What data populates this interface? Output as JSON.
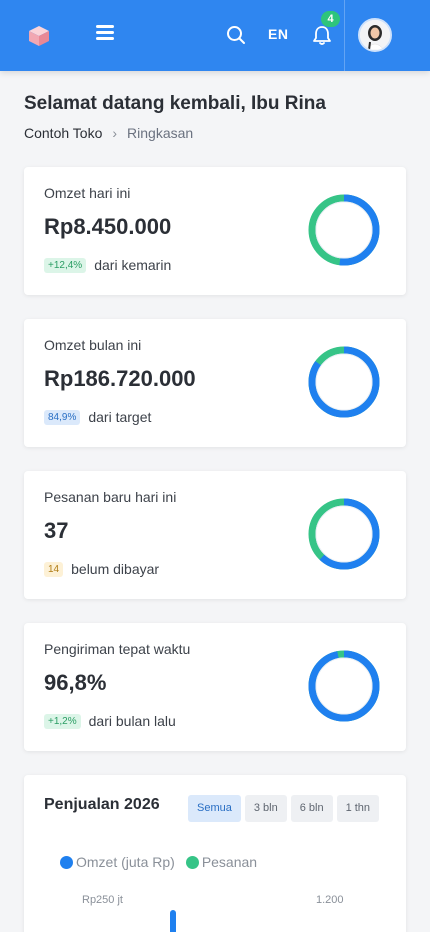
{
  "header": {
    "language": "EN",
    "notifications_count": "4",
    "accent": "#2f86f0"
  },
  "greeting": "Selamat datang kembali, Ibu Rina",
  "breadcrumb": {
    "items": [
      "Contoh Toko",
      "Ringkasan"
    ],
    "separator": "›"
  },
  "stats": [
    {
      "label": "Omzet hari ini",
      "value": "Rp8.450.000",
      "badge": "+12,4%",
      "badge_color": "green",
      "foot": "dari kemarin",
      "donut_fraction": 0.52
    },
    {
      "label": "Omzet bulan ini",
      "value": "Rp186.720.000",
      "badge": "84,9%",
      "badge_color": "blue",
      "foot": "dari target",
      "donut_fraction": 0.849
    },
    {
      "label": "Pesanan baru hari ini",
      "value": "37",
      "badge": "14",
      "badge_color": "yellow",
      "foot": "belum dibayar",
      "donut_fraction": 0.62
    },
    {
      "label": "Pengiriman tepat waktu",
      "value": "96,8%",
      "badge": "+1,2%",
      "badge_color": "green",
      "foot": "dari bulan lalu",
      "donut_fraction": 0.968
    }
  ],
  "colors": {
    "blue": "#1f80ef",
    "green": "#36c487"
  },
  "sales": {
    "title": "Penjualan 2026",
    "filters": [
      "Semua",
      "3 bln",
      "6 bln",
      "1 thn"
    ],
    "active_filter": "Semua",
    "legend": [
      "Omzet (juta Rp)",
      "Pesanan"
    ],
    "left_axis_top": "Rp250 jt",
    "right_axis_top": "1.200"
  }
}
